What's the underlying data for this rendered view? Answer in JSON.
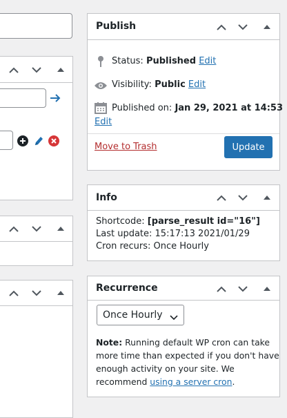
{
  "publish": {
    "title": "Publish",
    "status_label": "Status: ",
    "status_value": "Published",
    "visibility_label": "Visibility: ",
    "visibility_value": "Public",
    "published_label": "Published on: ",
    "published_value": "Jan 29, 2021 at 14:53",
    "edit": "Edit",
    "trash": "Move to Trash",
    "update": "Update"
  },
  "info": {
    "title": "Info",
    "shortcode_label": "Shortcode: ",
    "shortcode_value": "[parse_result id=\"16\"]",
    "last_update": "Last update: 15:17:13 2021/01/29",
    "cron": "Cron recurs: Once Hourly"
  },
  "recurrence": {
    "title": "Recurrence",
    "selected": "Once Hourly",
    "note_label": "Note:",
    "note_line1": " Running default WP cron can take",
    "note_line2": "more time than expected if you don't have",
    "note_line3": "enough activity on your site. We",
    "note_prefix": "recommend ",
    "note_link": "using a server cron",
    "note_suffix": "."
  },
  "icons": {
    "arrow": "arrow-right-icon",
    "add": "plus-circle-icon",
    "edit": "pencil-icon",
    "remove": "remove-circle-icon",
    "pin": "pin-icon",
    "eye": "eye-icon",
    "calendar": "calendar-icon"
  },
  "colors": {
    "accent": "#2271b1",
    "danger": "#b32d2e",
    "border": "#c3c4c7",
    "background": "#f0f0f1"
  }
}
